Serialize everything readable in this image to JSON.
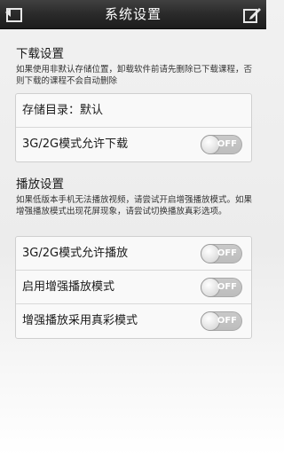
{
  "titlebar": {
    "title": "系统设置",
    "back_icon": "back-icon",
    "edit_icon": "edit-icon"
  },
  "download_section": {
    "heading": "下载设置",
    "hint": "如果使用非默认存储位置，卸载软件前请先删除已下载课程，否则下载的课程不会自动删除",
    "rows": [
      {
        "label": "存储目录：默认"
      },
      {
        "label": "3G/2G模式允许下载",
        "toggle": "OFF"
      }
    ]
  },
  "playback_section": {
    "heading": "播放设置",
    "hint": "如果低版本手机无法播放视频，请尝试开启增强播放模式。如果增强播放模式出现花屏现象，请尝试切换播放真彩选项。",
    "rows": [
      {
        "label": "3G/2G模式允许播放",
        "toggle": "OFF"
      },
      {
        "label": "启用增强播放模式",
        "toggle": "OFF"
      },
      {
        "label": "增强播放采用真彩模式",
        "toggle": "OFF"
      }
    ]
  }
}
